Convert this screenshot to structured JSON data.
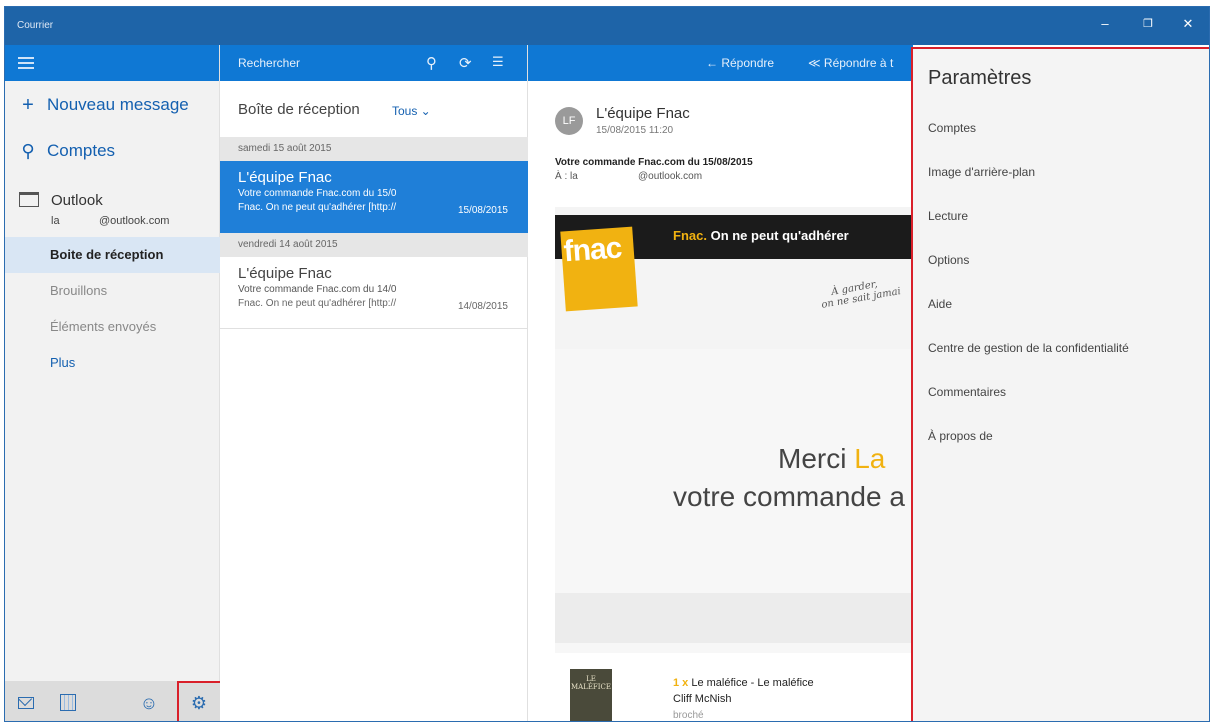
{
  "window": {
    "title": "Courrier",
    "minimize": "–",
    "maximize": "❐",
    "close": "✕"
  },
  "left": {
    "new_message": "Nouveau message",
    "accounts": "Comptes",
    "account": {
      "name": "Outlook",
      "email_user": "la",
      "email_domain": "@outlook.com"
    },
    "folders": [
      {
        "label": "Boite de réception",
        "active": true
      },
      {
        "label": "Brouillons",
        "active": false
      },
      {
        "label": "Éléments envoyés",
        "active": false
      },
      {
        "label": "Plus",
        "active": false
      }
    ]
  },
  "list": {
    "search_label": "Rechercher",
    "inbox_title": "Boîte de réception",
    "filter": "Tous ⌄",
    "groups": [
      {
        "date": "samedi 15 août 2015",
        "from": "L'équipe Fnac",
        "subject": "Votre commande Fnac.com du 15/0",
        "preview": "Fnac. On ne peut qu'adhérer [http://",
        "msg_date": "15/08/2015",
        "selected": true
      },
      {
        "date": "vendredi 14 août 2015",
        "from": "L'équipe Fnac",
        "subject": "Votre commande Fnac.com du 14/0",
        "preview": "Fnac. On ne peut qu'adhérer [http://",
        "msg_date": "14/08/2015",
        "selected": false
      }
    ]
  },
  "reading": {
    "reply": "← Répondre",
    "reply_all": "≪ Répondre à t",
    "avatar_initials": "LF",
    "sender": "L'équipe Fnac",
    "sent": "15/08/2015 11:20",
    "subject": "Votre commande Fnac.com du 15/08/2015",
    "to_label": "À : la",
    "to_addr": "@outlook.com",
    "banner_logo": "fnac",
    "banner_brand": "Fnac.",
    "banner_tagline": " On ne peut qu'adhérer",
    "handnote_line1": "À garder,",
    "handnote_line2": "on ne sait jamai",
    "merci": "Merci ",
    "merci_name": "La",
    "commande": "votre commande a",
    "product": {
      "qty": "1 x",
      "title": " Le maléfice - Le maléfice",
      "author": "Cliff McNish",
      "format": "broché",
      "cover_line1": "LE",
      "cover_line2": "MALÉFICE"
    }
  },
  "settings": {
    "title": "Paramètres",
    "items": [
      "Comptes",
      "Image d'arrière-plan",
      "Lecture",
      "Options",
      "Aide",
      "Centre de gestion de la confidentialité",
      "Commentaires",
      "À propos de"
    ]
  },
  "colors": {
    "accent": "#0f78d4",
    "titlebar": "#1e64a8",
    "highlight": "#d9202a",
    "brand": "#f1b211"
  }
}
